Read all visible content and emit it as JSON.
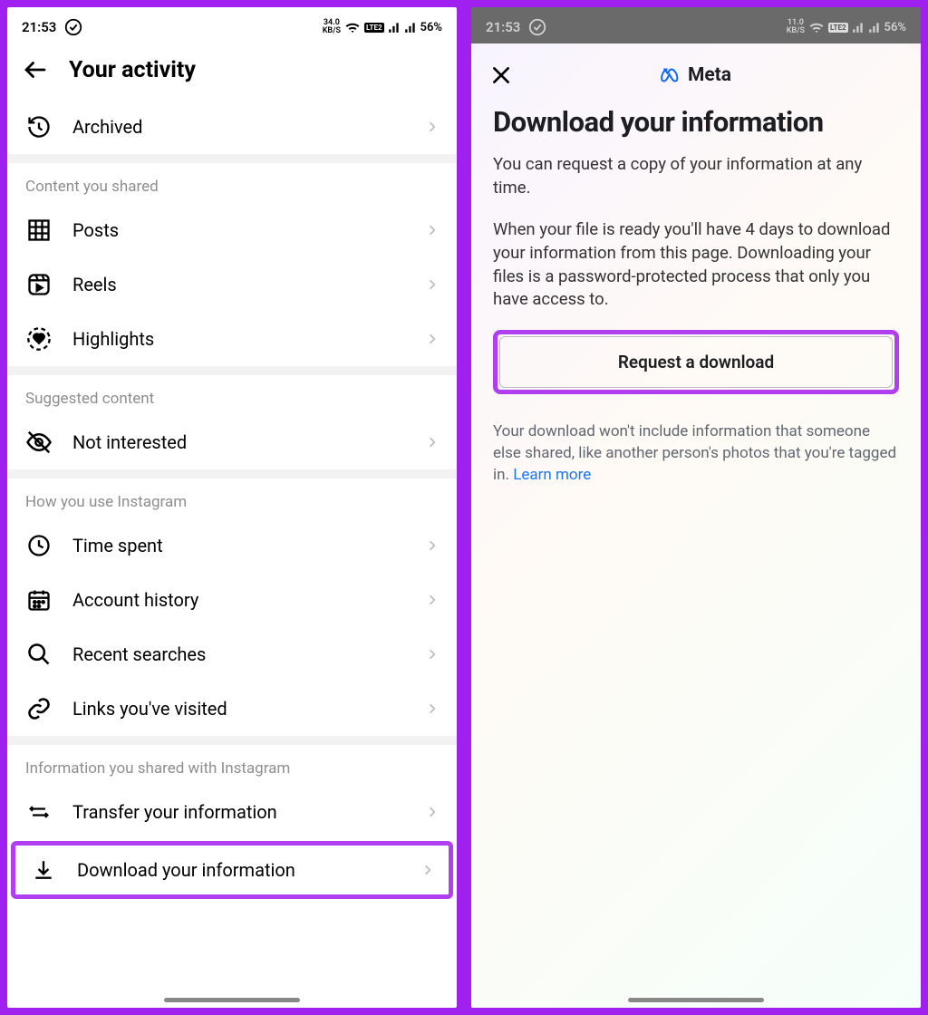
{
  "status": {
    "time": "21:53",
    "kbs_left": "34.0",
    "kbs_right": "11.0",
    "kbs_unit": "KB/S",
    "lte_badge": "Vo LTE 2",
    "battery": "56%"
  },
  "left": {
    "title": "Your activity",
    "archived": "Archived",
    "section_content": "Content you shared",
    "posts": "Posts",
    "reels": "Reels",
    "highlights": "Highlights",
    "section_suggested": "Suggested content",
    "not_interested": "Not interested",
    "section_usage": "How you use Instagram",
    "time_spent": "Time spent",
    "account_history": "Account history",
    "recent_searches": "Recent searches",
    "links_visited": "Links you've visited",
    "section_info": "Information you shared with Instagram",
    "transfer": "Transfer your information",
    "download": "Download your information"
  },
  "right": {
    "brand": "Meta",
    "title": "Download your information",
    "p1": "You can request a copy of your information at any time.",
    "p2": "When your file is ready you'll have 4 days to download your information from this page. Downloading your files is a password-protected process that only you have access to.",
    "button": "Request a download",
    "note": "Your download won't include information that someone else shared, like another person's photos that you're tagged in. ",
    "learn_more": "Learn more"
  }
}
